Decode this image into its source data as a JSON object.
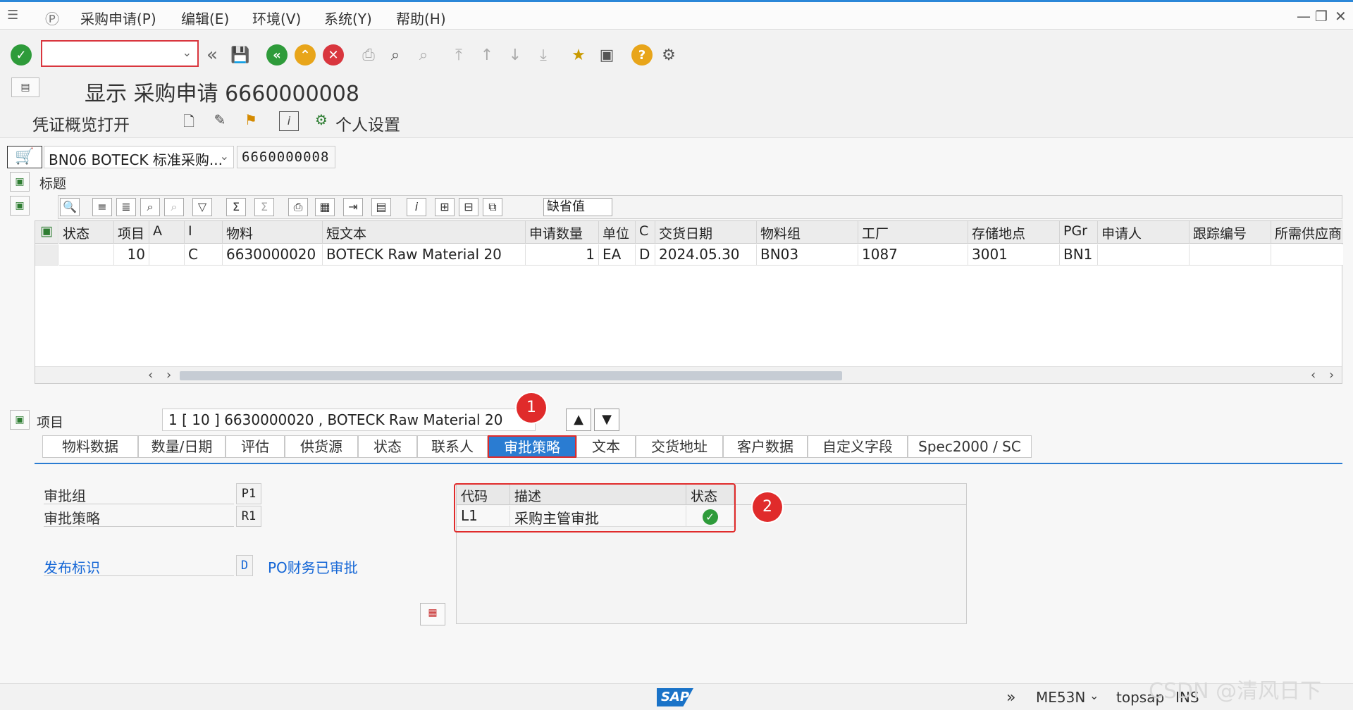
{
  "menubar": {
    "items": [
      "采购申请(P)",
      "编辑(E)",
      "环境(V)",
      "系统(Y)",
      "帮助(H)"
    ]
  },
  "toolbar": {
    "command_field_value": ""
  },
  "title": "显示 采购申请 6660000008",
  "appbar": {
    "overview_label": "凭证概览打开",
    "personal_settings_label": "个人设置"
  },
  "header": {
    "doc_type": "BN06 BOTECK 标准采购...",
    "doc_number": "6660000008",
    "header_label": "标题"
  },
  "grid_toolbar": {
    "default_values_label": "缺省值"
  },
  "grid": {
    "columns": [
      "状态",
      "项目",
      "A",
      "I",
      "物料",
      "短文本",
      "申请数量",
      "单位",
      "C",
      "交货日期",
      "物料组",
      "工厂",
      "存储地点",
      "PGr",
      "申请人",
      "跟踪编号",
      "所需供应商"
    ],
    "rows": [
      [
        "",
        "10",
        "",
        "C",
        "6630000020",
        "BOTECK Raw Material 20",
        "1",
        "EA",
        "D",
        "2024.05.30",
        "BN03",
        "1087",
        "3001",
        "BN1",
        "",
        "",
        ""
      ]
    ]
  },
  "item": {
    "label": "项目",
    "value": "1 [ 10 ] 6630000020 , BOTECK Raw Material 20"
  },
  "tabs": [
    "物料数据",
    "数量/日期",
    "评估",
    "供货源",
    "状态",
    "联系人",
    "审批策略",
    "文本",
    "交货地址",
    "客户数据",
    "自定义字段",
    "Spec2000 / SC"
  ],
  "active_tab": "审批策略",
  "approval": {
    "group_label": "审批组",
    "group_value": "P1",
    "strategy_label": "审批策略",
    "strategy_value": "R1",
    "release_label": "发布标识",
    "release_value": "D",
    "release_text": "PO财务已审批"
  },
  "strategy_table": {
    "headers": [
      "代码",
      "描述",
      "状态"
    ],
    "rows": [
      [
        "L1",
        "采购主管审批",
        ""
      ]
    ]
  },
  "annotations": [
    "1",
    "2"
  ],
  "statusbar": {
    "sap": "SAP",
    "transaction": "ME53N",
    "server": "topsap",
    "mode": "INS",
    "watermark": "CSDN @清风日下"
  }
}
